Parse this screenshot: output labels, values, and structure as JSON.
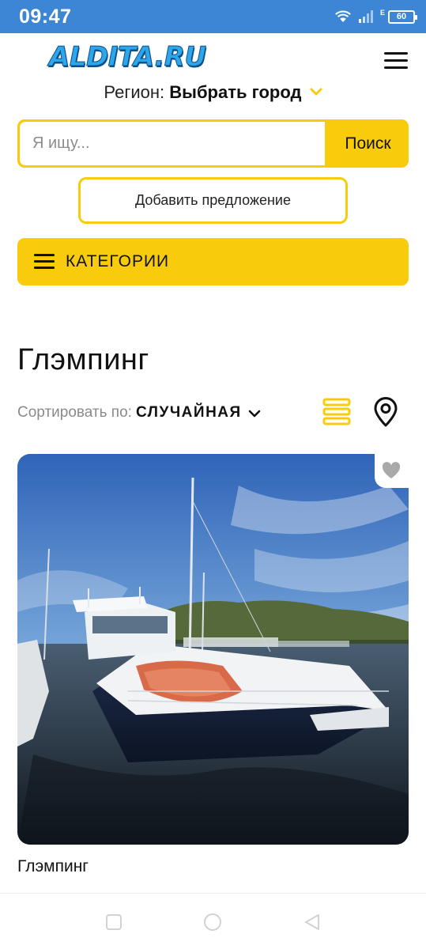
{
  "status_bar": {
    "time": "09:47",
    "network_type": "E",
    "battery_level": "60",
    "icons": [
      "wifi-icon",
      "signal-icon",
      "battery-icon"
    ]
  },
  "header": {
    "logo_text": "ALDITA.RU",
    "menu_icon": "hamburger-icon",
    "region_label": "Регион:",
    "region_value": "Выбрать город"
  },
  "search": {
    "placeholder": "Я ищу...",
    "value": "",
    "button_label": "Поиск"
  },
  "add_offer_label": "Добавить предложение",
  "categories_label": "КАТЕГОРИИ",
  "page": {
    "title": "Глэмпинг",
    "sort_label": "Сортировать по:",
    "sort_value": "СЛУЧАЙНАЯ",
    "view_icons": [
      "list-view-icon",
      "map-pin-icon"
    ]
  },
  "listings": [
    {
      "title": "Глэмпинг",
      "image": "photo of a white motor yacht moored at a marina",
      "favorite_icon": "heart-icon"
    }
  ],
  "colors": {
    "status_bar": "#3d86d6",
    "accent_yellow": "#f8cc0c",
    "logo_blue": "#2ea6ea",
    "logo_outline": "#0c4f8a"
  },
  "nav_bar": {
    "buttons": [
      "recent-apps-button",
      "home-button",
      "back-button"
    ]
  }
}
